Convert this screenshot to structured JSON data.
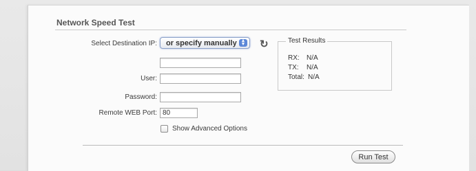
{
  "section": {
    "title": "Network Speed Test"
  },
  "form": {
    "destination_label": "Select Destination IP:",
    "destination_select_value": "or specify manually",
    "ip_field_value": "",
    "user_label": "User:",
    "user_value": "",
    "password_label": "Password:",
    "password_value": "",
    "remote_port_label": "Remote WEB Port:",
    "remote_port_value": "80",
    "advanced_label": "Show Advanced Options",
    "advanced_checked": false
  },
  "results": {
    "legend": "Test Results",
    "rx_label": "RX:",
    "rx_value": "N/A",
    "tx_label": "TX:",
    "tx_value": "N/A",
    "total_label": "Total:",
    "total_value": "N/A"
  },
  "actions": {
    "run_test_label": "Run Test"
  },
  "icons": {
    "refresh": "refresh-icon",
    "select_arrows": "updown-arrows-icon"
  },
  "colors": {
    "select_focus": "#5b87d8",
    "panel_bg": "#fbfbfb"
  }
}
